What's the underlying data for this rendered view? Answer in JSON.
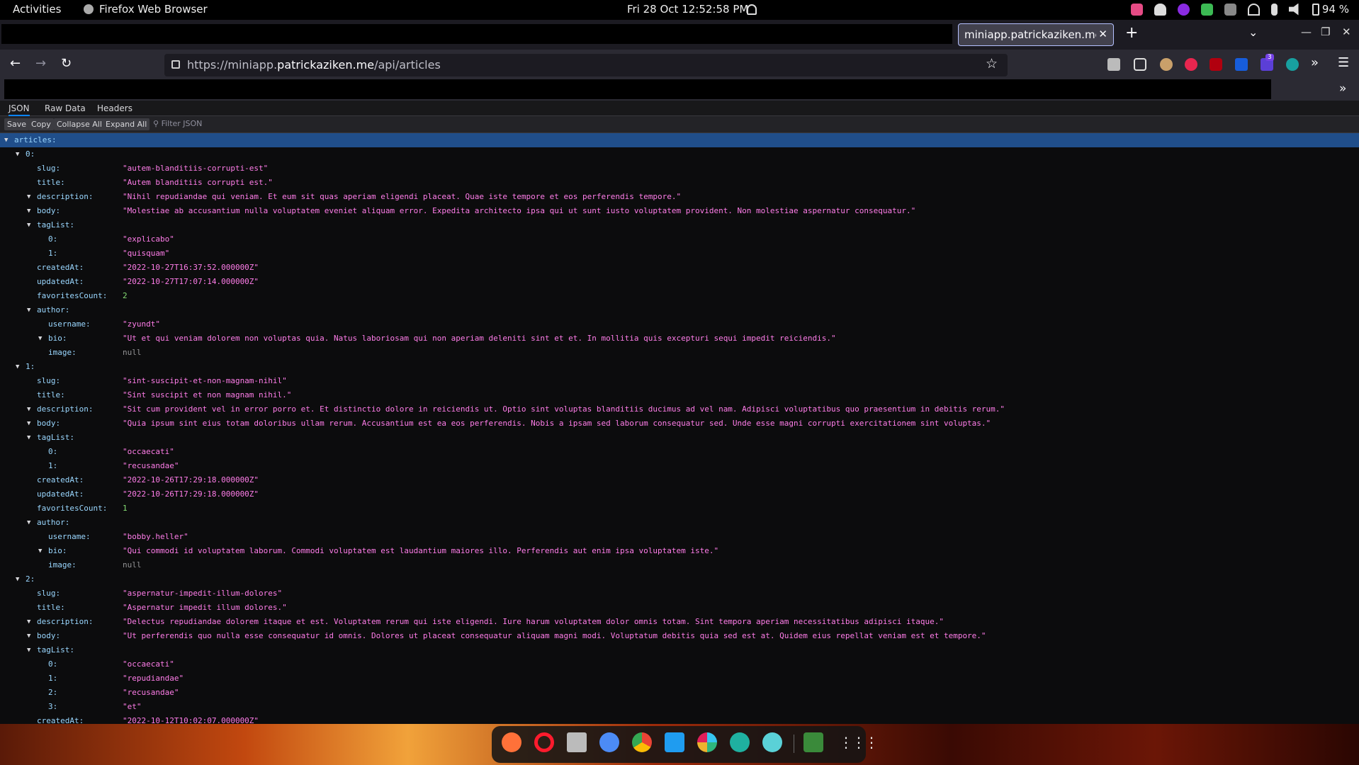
{
  "system": {
    "activities": "Activities",
    "app_name": "Firefox Web Browser",
    "clock": "Fri 28 Oct  12:52:58 PM",
    "battery": "94 %"
  },
  "browser": {
    "tab_title": "miniapp.patrickaziken.me/api/articles",
    "url_prefix": "https://miniapp.",
    "url_domain": "patrickaziken.me",
    "url_path": "/api/articles",
    "extension_badge": "3"
  },
  "viewer": {
    "tabs": [
      "JSON",
      "Raw Data",
      "Headers"
    ],
    "toolbar": {
      "save": "Save",
      "copy": "Copy",
      "collapse": "Collapse All",
      "expand": "Expand All",
      "filter_placeholder": "Filter JSON"
    }
  },
  "json_rows": [
    {
      "key": "articles:",
      "depth": 0,
      "twisty": true,
      "value": "",
      "type": "",
      "selected": true
    },
    {
      "key": "0:",
      "depth": 1,
      "twisty": true,
      "value": "",
      "type": ""
    },
    {
      "key": "slug:",
      "depth": 2,
      "value": "\"autem-blanditiis-corrupti-est\"",
      "type": "str"
    },
    {
      "key": "title:",
      "depth": 2,
      "value": "\"Autem blanditiis corrupti est.\"",
      "type": "str"
    },
    {
      "key": "description:",
      "depth": 2,
      "twisty": true,
      "value": "\"Nihil repudiandae qui veniam. Et eum sit quas aperiam eligendi placeat. Quae iste tempore et eos perferendis tempore.\"",
      "type": "str"
    },
    {
      "key": "body:",
      "depth": 2,
      "twisty": true,
      "value": "\"Molestiae ab accusantium nulla voluptatem eveniet aliquam error. Expedita architecto ipsa qui ut sunt iusto voluptatem provident. Non molestiae aspernatur consequatur.\"",
      "type": "str"
    },
    {
      "key": "tagList:",
      "depth": 2,
      "twisty": true,
      "value": "",
      "type": ""
    },
    {
      "key": "0:",
      "depth": 3,
      "value": "\"explicabo\"",
      "type": "str"
    },
    {
      "key": "1:",
      "depth": 3,
      "value": "\"quisquam\"",
      "type": "str"
    },
    {
      "key": "createdAt:",
      "depth": 2,
      "value": "\"2022-10-27T16:37:52.000000Z\"",
      "type": "str"
    },
    {
      "key": "updatedAt:",
      "depth": 2,
      "value": "\"2022-10-27T17:07:14.000000Z\"",
      "type": "str"
    },
    {
      "key": "favoritesCount:",
      "depth": 2,
      "value": "2",
      "type": "num"
    },
    {
      "key": "author:",
      "depth": 2,
      "twisty": true,
      "value": "",
      "type": ""
    },
    {
      "key": "username:",
      "depth": 3,
      "value": "\"zyundt\"",
      "type": "str"
    },
    {
      "key": "bio:",
      "depth": 3,
      "twisty": true,
      "value": "\"Ut et qui veniam dolorem non voluptas quia. Natus laboriosam qui non aperiam deleniti sint et et. In mollitia quis excepturi sequi impedit reiciendis.\"",
      "type": "str"
    },
    {
      "key": "image:",
      "depth": 3,
      "value": "null",
      "type": "nul"
    },
    {
      "key": "1:",
      "depth": 1,
      "twisty": true,
      "value": "",
      "type": ""
    },
    {
      "key": "slug:",
      "depth": 2,
      "value": "\"sint-suscipit-et-non-magnam-nihil\"",
      "type": "str"
    },
    {
      "key": "title:",
      "depth": 2,
      "value": "\"Sint suscipit et non magnam nihil.\"",
      "type": "str"
    },
    {
      "key": "description:",
      "depth": 2,
      "twisty": true,
      "value": "\"Sit cum provident vel in error porro et. Et distinctio dolore in reiciendis ut. Optio sint voluptas blanditiis ducimus ad vel nam. Adipisci voluptatibus quo praesentium in debitis rerum.\"",
      "type": "str"
    },
    {
      "key": "body:",
      "depth": 2,
      "twisty": true,
      "value": "\"Quia ipsum sint eius totam doloribus ullam rerum. Accusantium est ea eos perferendis. Nobis a ipsam sed laborum consequatur sed. Unde esse magni corrupti exercitationem sint voluptas.\"",
      "type": "str"
    },
    {
      "key": "tagList:",
      "depth": 2,
      "twisty": true,
      "value": "",
      "type": ""
    },
    {
      "key": "0:",
      "depth": 3,
      "value": "\"occaecati\"",
      "type": "str"
    },
    {
      "key": "1:",
      "depth": 3,
      "value": "\"recusandae\"",
      "type": "str"
    },
    {
      "key": "createdAt:",
      "depth": 2,
      "value": "\"2022-10-26T17:29:18.000000Z\"",
      "type": "str"
    },
    {
      "key": "updatedAt:",
      "depth": 2,
      "value": "\"2022-10-26T17:29:18.000000Z\"",
      "type": "str"
    },
    {
      "key": "favoritesCount:",
      "depth": 2,
      "value": "1",
      "type": "num"
    },
    {
      "key": "author:",
      "depth": 2,
      "twisty": true,
      "value": "",
      "type": ""
    },
    {
      "key": "username:",
      "depth": 3,
      "value": "\"bobby.heller\"",
      "type": "str"
    },
    {
      "key": "bio:",
      "depth": 3,
      "twisty": true,
      "value": "\"Qui commodi id voluptatem laborum. Commodi voluptatem est laudantium maiores illo. Perferendis aut enim ipsa voluptatem iste.\"",
      "type": "str"
    },
    {
      "key": "image:",
      "depth": 3,
      "value": "null",
      "type": "nul"
    },
    {
      "key": "2:",
      "depth": 1,
      "twisty": true,
      "value": "",
      "type": ""
    },
    {
      "key": "slug:",
      "depth": 2,
      "value": "\"aspernatur-impedit-illum-dolores\"",
      "type": "str"
    },
    {
      "key": "title:",
      "depth": 2,
      "value": "\"Aspernatur impedit illum dolores.\"",
      "type": "str"
    },
    {
      "key": "description:",
      "depth": 2,
      "twisty": true,
      "value": "\"Delectus repudiandae dolorem itaque et est. Voluptatem rerum qui iste eligendi. Iure harum voluptatem dolor omnis totam. Sint tempora aperiam necessitatibus adipisci itaque.\"",
      "type": "str"
    },
    {
      "key": "body:",
      "depth": 2,
      "twisty": true,
      "value": "\"Ut perferendis quo nulla esse consequatur id omnis. Dolores ut placeat consequatur aliquam magni modi. Voluptatum debitis quia sed est at. Quidem eius repellat veniam est et tempore.\"",
      "type": "str"
    },
    {
      "key": "tagList:",
      "depth": 2,
      "twisty": true,
      "value": "",
      "type": ""
    },
    {
      "key": "0:",
      "depth": 3,
      "value": "\"occaecati\"",
      "type": "str"
    },
    {
      "key": "1:",
      "depth": 3,
      "value": "\"repudiandae\"",
      "type": "str"
    },
    {
      "key": "2:",
      "depth": 3,
      "value": "\"recusandae\"",
      "type": "str"
    },
    {
      "key": "3:",
      "depth": 3,
      "value": "\"et\"",
      "type": "str"
    },
    {
      "key": "createdAt:",
      "depth": 2,
      "value": "\"2022-10-12T10:02:07.000000Z\"",
      "type": "str"
    }
  ],
  "dock": {
    "apps": [
      "firefox-icon",
      "opera-icon",
      "files-icon",
      "chromium-icon",
      "chrome-icon",
      "vscode-icon",
      "slack-icon",
      "edge-icon",
      "chat-icon",
      "trash-icon"
    ]
  }
}
